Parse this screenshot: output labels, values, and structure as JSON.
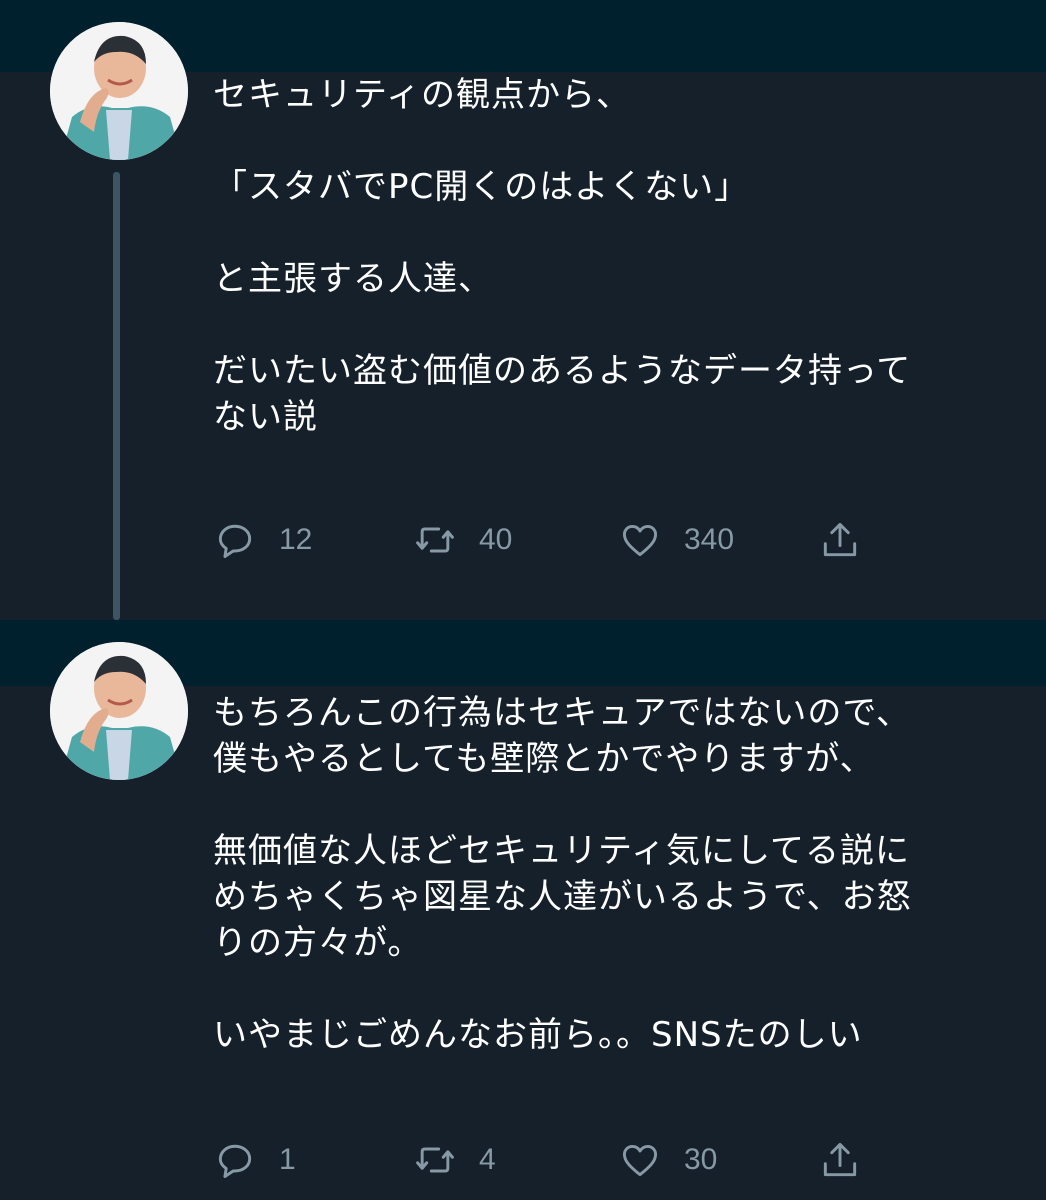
{
  "colors": {
    "background": "#15202b",
    "header_bar": "#00202e",
    "thread_line": "#3d5466",
    "text": "#ffffff",
    "secondary_text": "#8899a6"
  },
  "tweets": [
    {
      "avatar": "profile-avatar",
      "paragraphs": [
        "セキュリティの観点から、",
        "「スタバでPC開くのはよくない」",
        "と主張する人達、",
        "だいたい盗む価値のあるようなデータ持って\nない説"
      ],
      "actions": {
        "reply": {
          "icon": "reply-icon",
          "count": "12"
        },
        "retweet": {
          "icon": "retweet-icon",
          "count": "40"
        },
        "like": {
          "icon": "heart-icon",
          "count": "340"
        },
        "share": {
          "icon": "share-icon"
        }
      }
    },
    {
      "avatar": "profile-avatar",
      "paragraphs": [
        "もちろんこの行為はセキュアではないので、\n僕もやるとしても壁際とかでやりますが、",
        "無価値な人ほどセキュリティ気にしてる説に\nめちゃくちゃ図星な人達がいるようで、お怒\nりの方々が。",
        "いやまじごめんなお前ら。。SNSたのしい"
      ],
      "actions": {
        "reply": {
          "icon": "reply-icon",
          "count": "1"
        },
        "retweet": {
          "icon": "retweet-icon",
          "count": "4"
        },
        "like": {
          "icon": "heart-icon",
          "count": "30"
        },
        "share": {
          "icon": "share-icon"
        }
      }
    }
  ]
}
